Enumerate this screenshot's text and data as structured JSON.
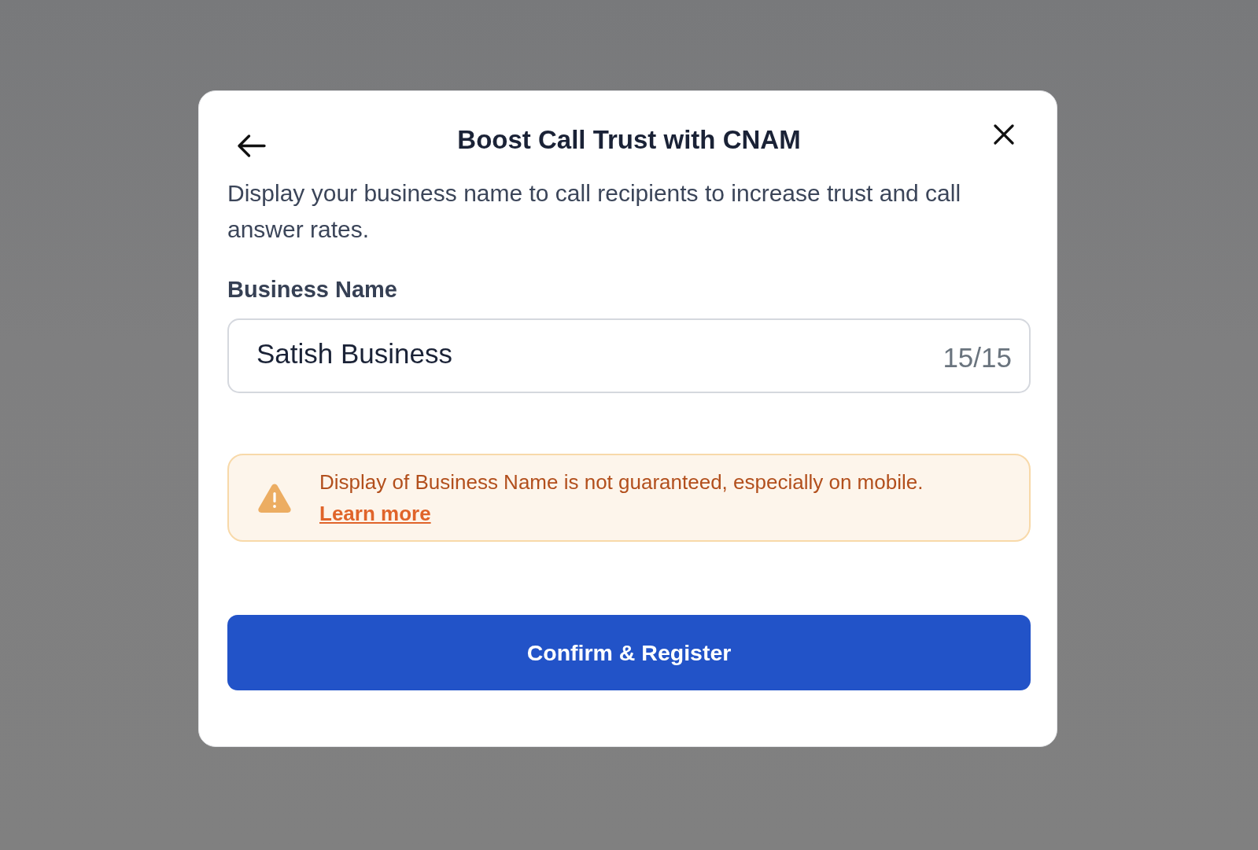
{
  "dialog": {
    "title": "Boost Call Trust with CNAM",
    "description": "Display your business name to call recipients to increase trust and call answer rates."
  },
  "field": {
    "label": "Business Name",
    "value": "Satish Business",
    "counter": "15/15"
  },
  "warning": {
    "text": "Display of Business Name is not guaranteed, especially on mobile.",
    "link": "Learn more"
  },
  "primary_button": "Confirm & Register"
}
